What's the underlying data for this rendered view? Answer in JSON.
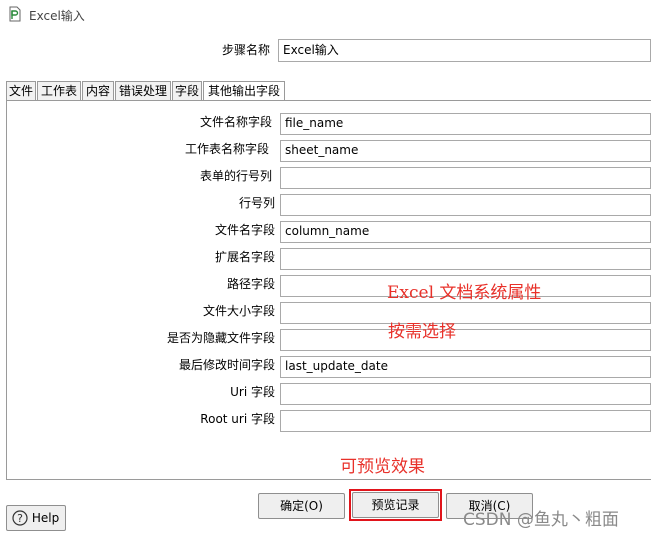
{
  "window": {
    "title": "Excel输入",
    "icon": "spoon-document-icon"
  },
  "step_name": {
    "label": "步骤名称",
    "value": "Excel输入"
  },
  "tabs": [
    {
      "label": "文件"
    },
    {
      "label": "工作表"
    },
    {
      "label": "内容"
    },
    {
      "label": "错误处理"
    },
    {
      "label": "字段"
    },
    {
      "label": "其他输出字段",
      "active": true
    }
  ],
  "fields": [
    {
      "label": "文件名称字段",
      "value": "file_name"
    },
    {
      "label": "工作表名称字段",
      "value": "sheet_name"
    },
    {
      "label": "表单的行号列",
      "value": ""
    },
    {
      "label": "行号列",
      "value": ""
    },
    {
      "label": "文件名字段",
      "value": "column_name"
    },
    {
      "label": "扩展名字段",
      "value": ""
    },
    {
      "label": "路径字段",
      "value": ""
    },
    {
      "label": "文件大小字段",
      "value": ""
    },
    {
      "label": "是否为隐藏文件字段",
      "value": ""
    },
    {
      "label": "最后修改时间字段",
      "value": "last_update_date"
    },
    {
      "label": "Uri 字段",
      "value": ""
    },
    {
      "label": "Root uri 字段",
      "value": ""
    }
  ],
  "annotations": {
    "note1": "Excel 文档系统属性",
    "note2": "按需选择",
    "note3": "可预览效果",
    "color": "#e8312a"
  },
  "buttons": {
    "help": "Help",
    "ok": "确定(O)",
    "preview": "预览记录",
    "cancel": "取消(C)"
  },
  "watermark": "CSDN @鱼丸丶粗面"
}
